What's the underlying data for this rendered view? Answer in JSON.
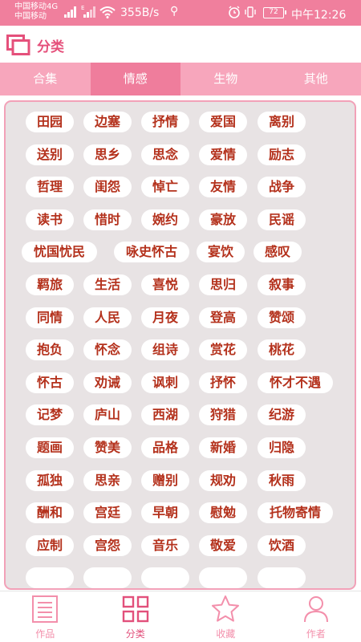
{
  "status_bar": {
    "carrier_1": "中国移动4G",
    "carrier_2": "中国移动",
    "network_tag": "4G",
    "e_tag": "E",
    "net_speed": "355B/s",
    "battery": "72",
    "time": "中午12:26"
  },
  "header": {
    "title": "分类"
  },
  "tabs": [
    {
      "label": "合集",
      "active": false
    },
    {
      "label": "情感",
      "active": true
    },
    {
      "label": "生物",
      "active": false
    },
    {
      "label": "其他",
      "active": false
    }
  ],
  "categories": [
    [
      "田园",
      "边塞",
      "抒情",
      "爱国",
      "离别"
    ],
    [
      "送别",
      "思乡",
      "思念",
      "爱情",
      "励志"
    ],
    [
      "哲理",
      "闺怨",
      "悼亡",
      "友情",
      "战争"
    ],
    [
      "读书",
      "惜时",
      "婉约",
      "豪放",
      "民谣"
    ],
    [
      "忧国忧民",
      "咏史怀古",
      "宴饮",
      "感叹"
    ],
    [
      "羁旅",
      "生活",
      "喜悦",
      "思归",
      "叙事"
    ],
    [
      "同情",
      "人民",
      "月夜",
      "登高",
      "赞颂"
    ],
    [
      "抱负",
      "怀念",
      "组诗",
      "赏花",
      "桃花"
    ],
    [
      "怀古",
      "劝诫",
      "讽刺",
      "抒怀",
      "怀才不遇"
    ],
    [
      "记梦",
      "庐山",
      "西湖",
      "狩猎",
      "纪游"
    ],
    [
      "题画",
      "赞美",
      "品格",
      "新婚",
      "归隐"
    ],
    [
      "孤独",
      "思亲",
      "赠别",
      "规劝",
      "秋雨"
    ],
    [
      "酬和",
      "宫廷",
      "早朝",
      "慰勉",
      "托物寄情"
    ],
    [
      "应制",
      "宫怨",
      "音乐",
      "敬爱",
      "饮酒"
    ]
  ],
  "bottom_nav": [
    {
      "label": "作品",
      "icon": "list-icon",
      "active": false
    },
    {
      "label": "分类",
      "icon": "grid-icon",
      "active": true
    },
    {
      "label": "收藏",
      "icon": "star-icon",
      "active": false
    },
    {
      "label": "作者",
      "icon": "person-icon",
      "active": false
    }
  ],
  "colors": {
    "accent": "#ef7d9c",
    "tab_bar": "#f7a6bc",
    "chip_text": "#b4311c",
    "panel_bg": "#e8e3e4"
  }
}
